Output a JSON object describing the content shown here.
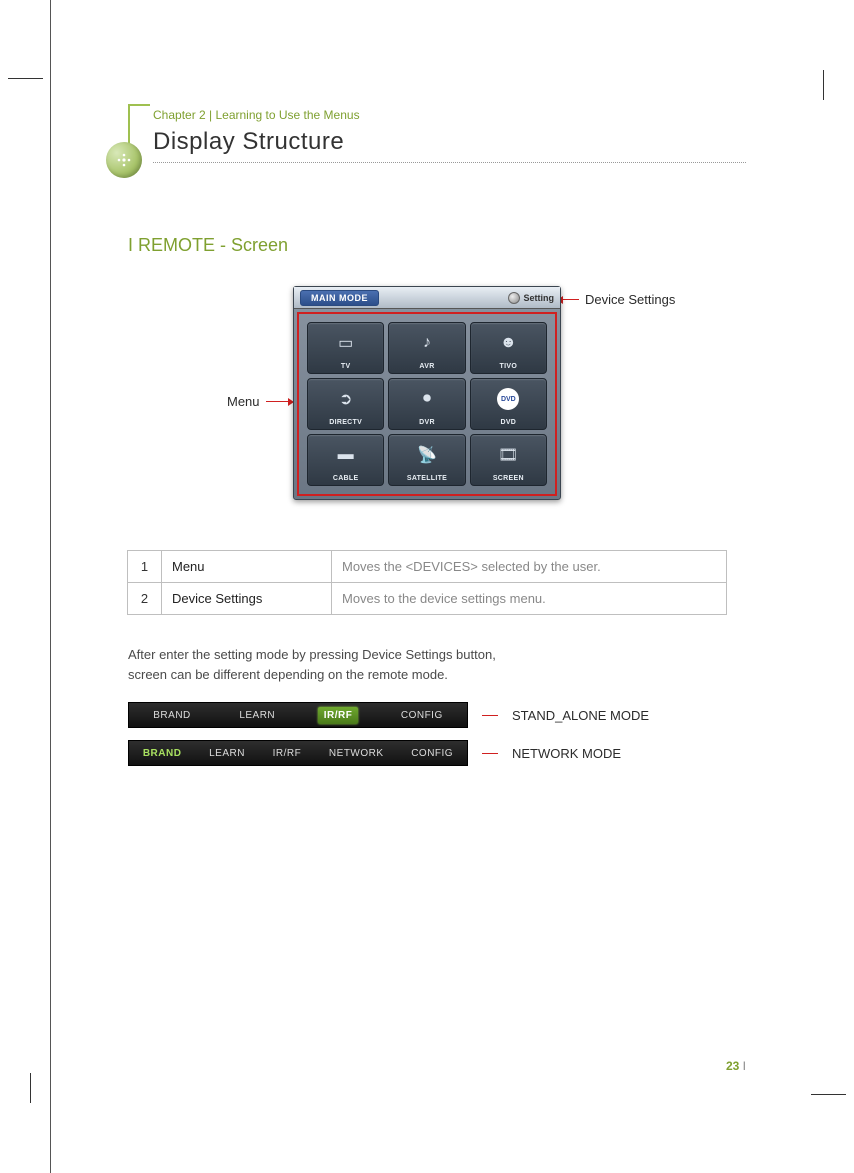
{
  "header": {
    "chapter": "Chapter 2 | Learning to Use the Menus",
    "title": "Display Structure"
  },
  "section_heading": "I REMOTE - Screen",
  "remote": {
    "titlebar_mode": "MAIN MODE",
    "titlebar_setting": "Setting",
    "devices": [
      {
        "label": "TV",
        "glyph": "▭"
      },
      {
        "label": "AVR",
        "glyph": "♪"
      },
      {
        "label": "TIVO",
        "glyph": "☻"
      },
      {
        "label": "DIRECTV",
        "glyph": "➲"
      },
      {
        "label": "DVR",
        "glyph": "⏺"
      },
      {
        "label": "DVD",
        "glyph": "DVD"
      },
      {
        "label": "CABLE",
        "glyph": "▬"
      },
      {
        "label": "SATELLITE",
        "glyph": "📡"
      },
      {
        "label": "SCREEN",
        "glyph": "🎞"
      }
    ]
  },
  "callouts": {
    "menu": "Menu",
    "device_settings": "Device Settings"
  },
  "table": {
    "rows": [
      {
        "n": "1",
        "name": "Menu",
        "desc": "Moves the <DEVICES> selected by the user."
      },
      {
        "n": "2",
        "name": "Device Settings",
        "desc": "Moves to the device settings menu."
      }
    ]
  },
  "note_line1": "After enter the setting mode by pressing Device Settings button,",
  "note_line2": "screen can be different depending on the remote mode.",
  "mode_bars": {
    "standalone": {
      "items": [
        "BRAND",
        "LEARN",
        "IR/RF",
        "CONFIG"
      ],
      "active": "IR/RF",
      "label": "STAND_ALONE MODE"
    },
    "network": {
      "items": [
        "BRAND",
        "LEARN",
        "IR/RF",
        "NETWORK",
        "CONFIG"
      ],
      "active": "BRAND",
      "label": "NETWORK MODE"
    }
  },
  "page_number": "23",
  "page_bar": "I"
}
